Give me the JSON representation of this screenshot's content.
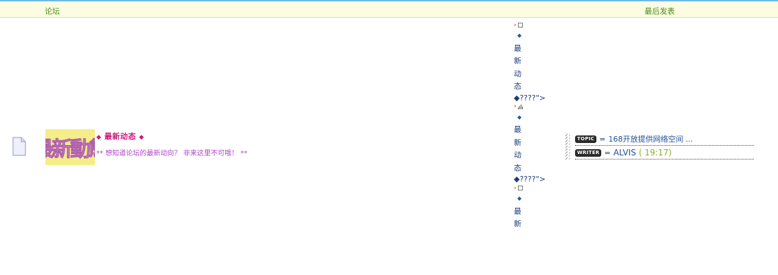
{
  "header": {
    "forum_col": "论坛",
    "last_post_col": "最后发表"
  },
  "forum": {
    "icon": "document-icon",
    "logo_text": "最新動態",
    "title": "最新动态",
    "title_deco": "◆",
    "description": "** 想知道论坛的最新动向？ 非来这里不可哦！ **"
  },
  "vertical_column": {
    "groups": [
      {
        "icon": "square",
        "chars": [
          "◆",
          "最",
          "新",
          "动",
          "态"
        ],
        "tail": "◆????\">"
      },
      {
        "icon": "bars",
        "chars": [
          "◆",
          "最",
          "新",
          "动",
          "态"
        ],
        "tail": "◆????\">"
      },
      {
        "icon": "square",
        "chars": [
          "◆",
          "最",
          "新"
        ],
        "tail": ""
      }
    ]
  },
  "last_post": {
    "topic_badge": "TOPIC",
    "topic_eq": "=",
    "topic_text": "168开放提供网络空间 ...",
    "writer_badge": "WRITER",
    "writer_eq": "=",
    "writer_name": "ALVIS",
    "time": "( 19:17)"
  }
}
